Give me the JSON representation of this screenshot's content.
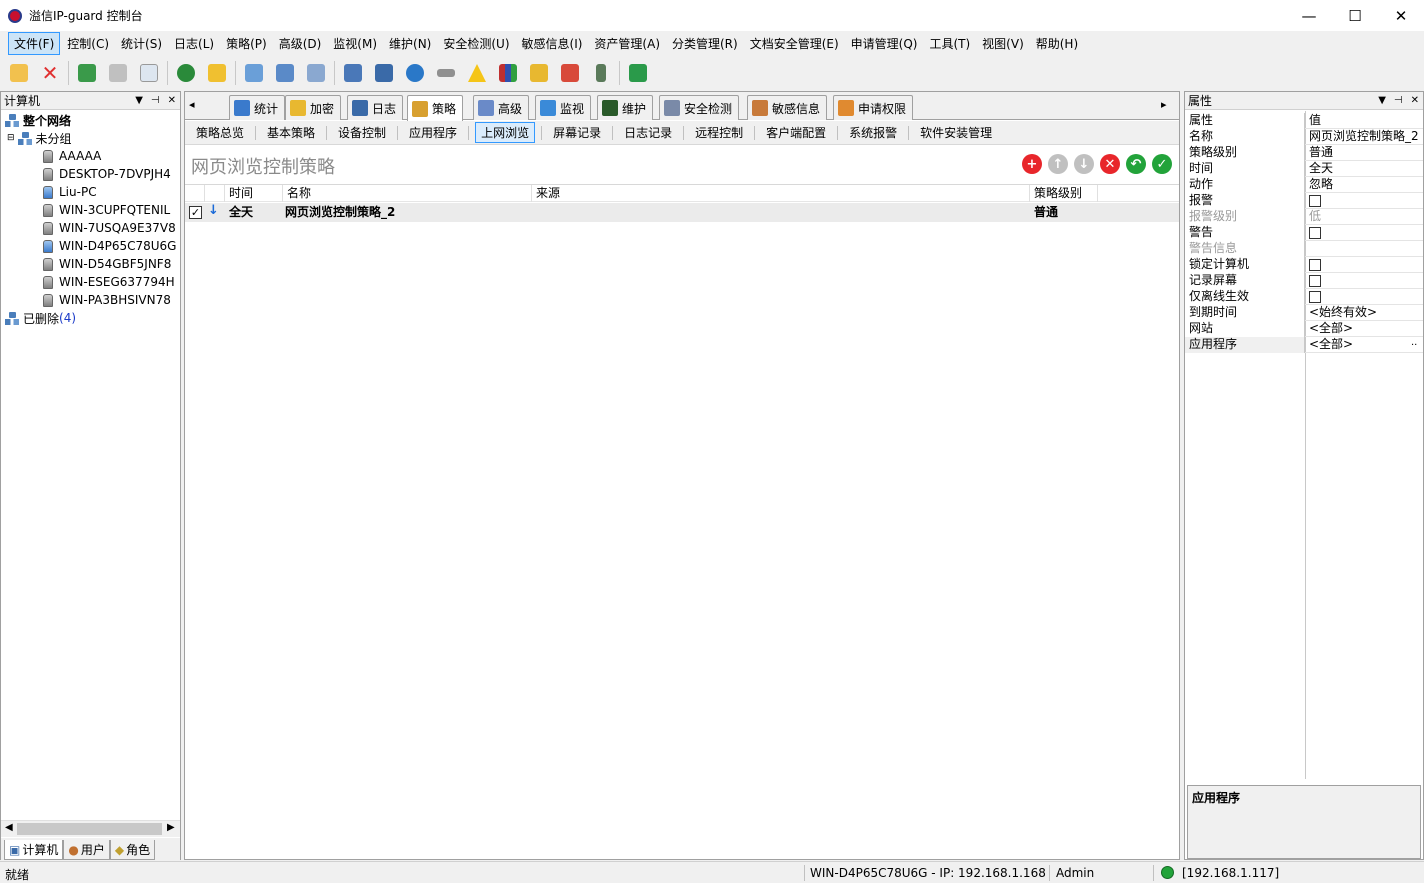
{
  "window": {
    "title": "溢信IP-guard 控制台",
    "min": "—",
    "max": "☐",
    "close": "✕"
  },
  "menu": [
    "文件(F)",
    "控制(C)",
    "统计(S)",
    "日志(L)",
    "策略(P)",
    "高级(D)",
    "监视(M)",
    "维护(N)",
    "安全检测(U)",
    "敏感信息(I)",
    "资产管理(A)",
    "分类管理(R)",
    "文档安全管理(E)",
    "申请管理(Q)",
    "工具(T)",
    "视图(V)",
    "帮助(H)"
  ],
  "toolbar_icons": [
    "new-icon",
    "delete-icon",
    "import-icon",
    "print-icon",
    "print-preview-icon",
    "help-icon",
    "note-icon",
    "copy-icon",
    "search-doc-icon",
    "export-icon",
    "computers-icon",
    "inventory-icon",
    "network-icon",
    "disk-icon",
    "warning-icon",
    "books-icon",
    "lock-icon",
    "edit-icon",
    "device-icon",
    "refresh-icon"
  ],
  "left_panel": {
    "title": "计算机",
    "root": "整个网络",
    "group": "未分组",
    "computers": [
      "AAAAA",
      "DESKTOP-7DVPJH4",
      "Liu-PC",
      "WIN-3CUPFQTENIL",
      "WIN-7USQA9E37V8",
      "WIN-D4P65C78U6G",
      "WIN-D54GBF5JNF8",
      "WIN-ESEG637794H",
      "WIN-PA3BHSIVN78"
    ],
    "deleted_label": "已删除",
    "deleted_count": "(4)",
    "bottom_tabs": [
      "计算机",
      "用户",
      "角色"
    ]
  },
  "tabs": [
    "统计",
    "加密",
    "日志",
    "策略",
    "高级",
    "监视",
    "维护",
    "安全检测",
    "敏感信息",
    "申请权限"
  ],
  "active_tab": "策略",
  "subtabs": [
    "策略总览",
    "基本策略",
    "设备控制",
    "应用程序",
    "上网浏览",
    "屏幕记录",
    "日志记录",
    "远程控制",
    "客户端配置",
    "系统报警",
    "软件安装管理"
  ],
  "active_subtab": "上网浏览",
  "policy": {
    "heading": "网页浏览控制策略",
    "columns": [
      "时间",
      "名称",
      "来源",
      "策略级别"
    ],
    "rows": [
      {
        "time": "全天",
        "name": "网页浏览控制策略_2",
        "source": "",
        "level": "普通"
      }
    ]
  },
  "properties": {
    "title": "属性",
    "header_key": "属性",
    "header_value": "值",
    "rows": [
      {
        "k": "名称",
        "v": "网页浏览控制策略_2"
      },
      {
        "k": "策略级别",
        "v": "普通"
      },
      {
        "k": "时间",
        "v": "全天"
      },
      {
        "k": "动作",
        "v": "忽略"
      },
      {
        "k": "报警",
        "v": ""
      },
      {
        "k": "报警级别",
        "v": "低"
      },
      {
        "k": "警告",
        "v": ""
      },
      {
        "k": "警告信息",
        "v": ""
      },
      {
        "k": "锁定计算机",
        "v": ""
      },
      {
        "k": "记录屏幕",
        "v": ""
      },
      {
        "k": "仅离线生效",
        "v": ""
      },
      {
        "k": "到期时间",
        "v": "<始终有效>"
      },
      {
        "k": "网站",
        "v": "<全部>"
      },
      {
        "k": "应用程序",
        "v": "<全部>"
      }
    ],
    "description_title": "应用程序",
    "ellipsis": ".."
  },
  "status": {
    "ready": "就绪",
    "host_ip": "WIN-D4P65C78U6G - IP: 192.168.1.168",
    "user": "Admin",
    "server": "[192.168.1.117]"
  },
  "colors": {
    "accent": "#3399ff",
    "add": "#e8262b",
    "delete": "#e8262b",
    "ok": "#22a33a",
    "disabled": "#b8b8b8"
  }
}
